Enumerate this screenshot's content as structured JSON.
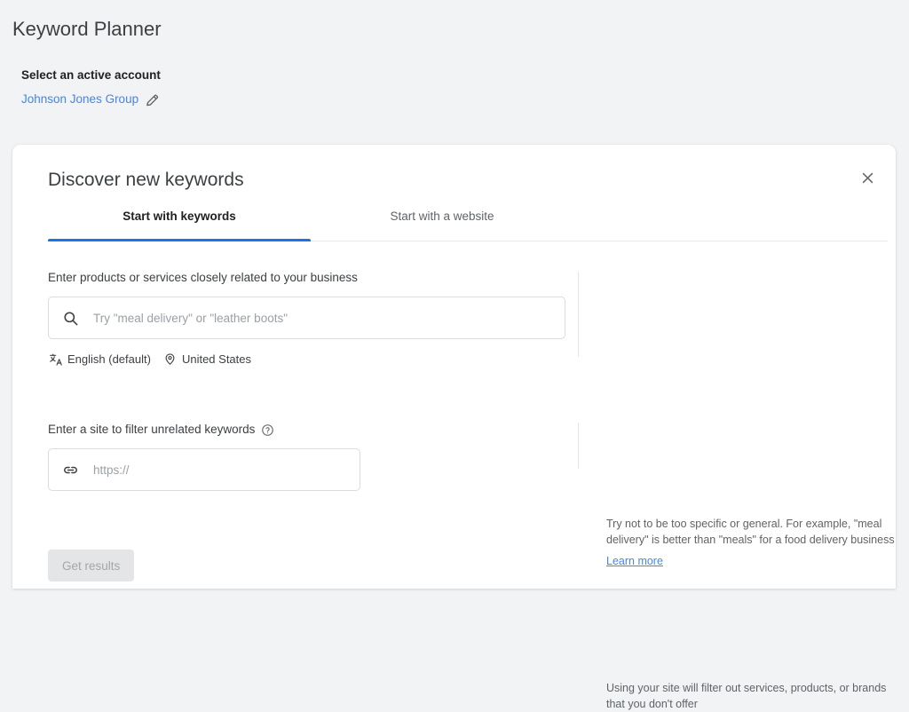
{
  "page": {
    "title": "Keyword Planner",
    "account_label": "Select an active account",
    "account_name": "Johnson Jones Group",
    "edit_icon": "pencil-icon"
  },
  "card": {
    "title": "Discover new keywords",
    "close_icon": "close-icon",
    "tabs": [
      {
        "label": "Start with keywords",
        "active": true
      },
      {
        "label": "Start with a website",
        "active": false
      }
    ],
    "keywords_section": {
      "label": "Enter products or services closely related to your business",
      "search_icon": "search-icon",
      "placeholder": "Try \"meal delivery\" or \"leather boots\"",
      "value": "",
      "language_icon": "translate-icon",
      "language": "English (default)",
      "location_icon": "location-pin-icon",
      "location": "United States",
      "helper_text": "Try not to be too specific or general. For example, \"meal delivery\" is better than \"meals\" for a food delivery business",
      "helper_link": "Learn more"
    },
    "site_section": {
      "label": "Enter a site to filter unrelated keywords",
      "help_icon": "help-circle-icon",
      "link_icon": "link-icon",
      "placeholder": "https://",
      "value": "",
      "helper_text": "Using your site will filter out services, products, or brands that you don't offer"
    },
    "submit_label": "Get results"
  },
  "colors": {
    "page_background": "#f1f3f4",
    "card_background": "#ffffff",
    "accent_blue": "#1a73e8",
    "link_blue": "#4285f4",
    "text_primary": "#202124",
    "text_secondary": "#5f6368",
    "border": "#dadce0",
    "disabled_button": "#e4e5e6"
  }
}
